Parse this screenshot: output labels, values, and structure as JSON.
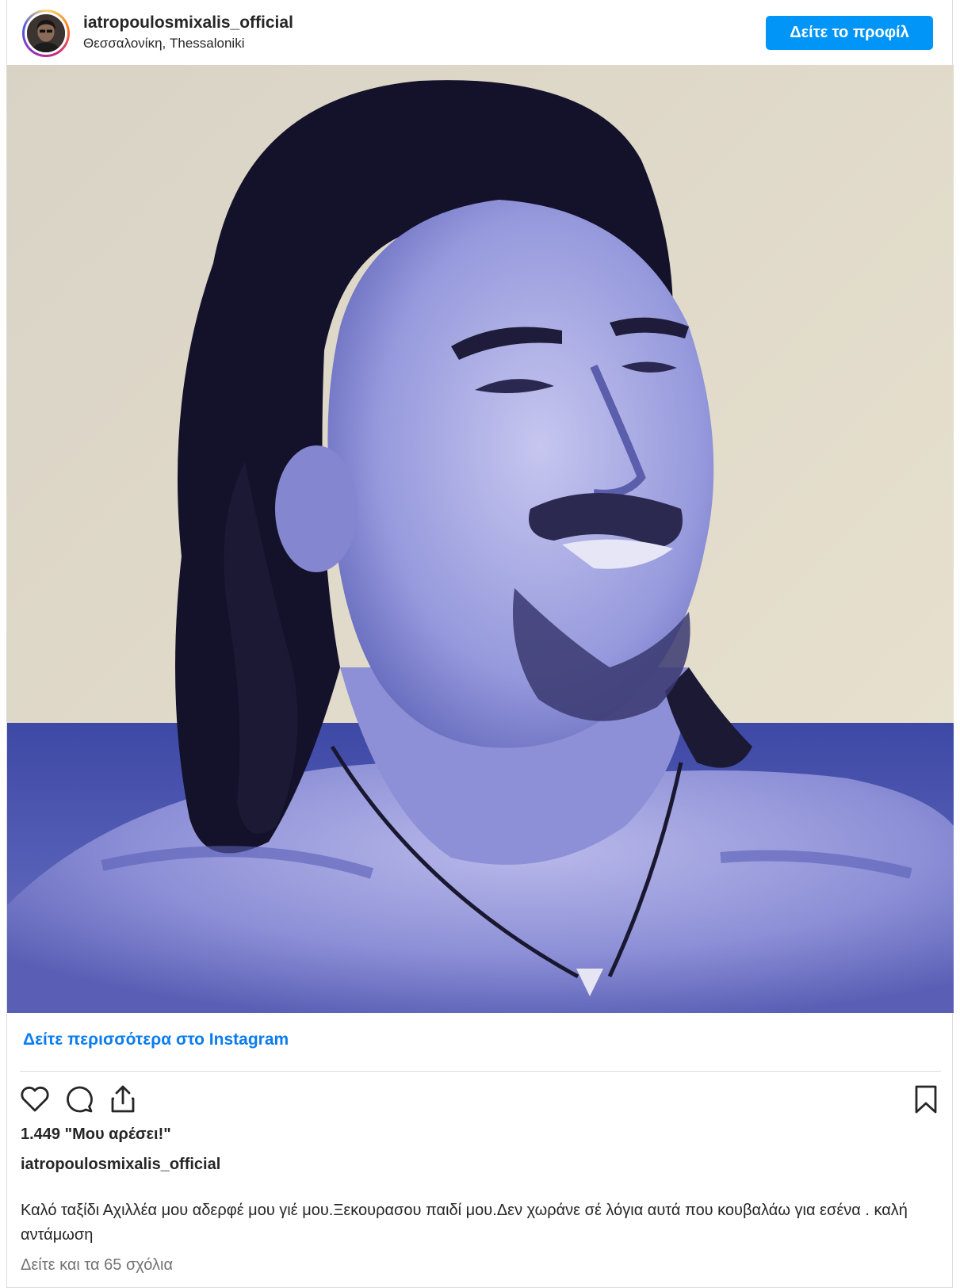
{
  "post": {
    "username": "iatropoulosmixalis_official",
    "location": "Θεσσαλονίκη, Thessaloniki",
    "view_profile_label": "Δείτε το προφίλ",
    "view_more_label": "Δείτε περισσότερα στο Instagram",
    "likes_text": "1.449 \"Μου αρέσει!\"",
    "caption_username": "iatropoulosmixalis_official",
    "caption_text": "Καλό ταξίδι Αχιλλέα μου αδερφέ μου γιέ μου.Ξεκουρασου παιδί μου.Δεν χωράνε σέ λόγια αυτά που κουβαλάω για εσένα . καλή αντάμωση",
    "comments_link": "Δείτε και τα 65 σχόλια"
  },
  "icons": [
    "heart-icon",
    "comment-icon",
    "share-icon",
    "bookmark-icon"
  ],
  "colors": {
    "primary_button": "#0095f6",
    "link": "#0a7cf0",
    "text": "#262626",
    "muted": "#737373",
    "border": "#dbdbdb"
  }
}
